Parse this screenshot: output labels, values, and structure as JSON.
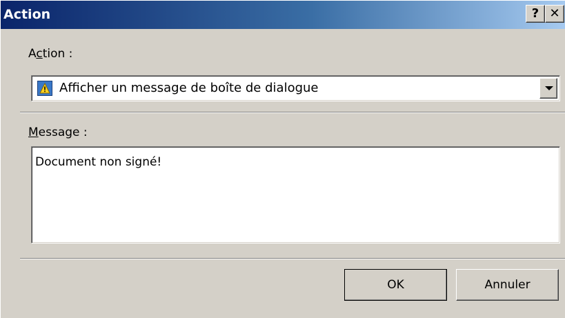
{
  "window": {
    "title": "Action"
  },
  "caption_buttons": {
    "help": "?",
    "close": "✕"
  },
  "action": {
    "label_prefix": "A",
    "label_accel": "c",
    "label_suffix": "tion :",
    "selected_value": "Afficher un message de boîte de dialogue",
    "selected_icon": "warning-icon"
  },
  "message": {
    "label_accel": "M",
    "label_suffix": "essage :",
    "value": "Document non signé!"
  },
  "buttons": {
    "ok": "OK",
    "cancel": "Annuler"
  },
  "colors": {
    "title_gradient_start": "#0a246a",
    "title_gradient_end": "#a6caf0",
    "dialog_face": "#d4d0c8"
  }
}
